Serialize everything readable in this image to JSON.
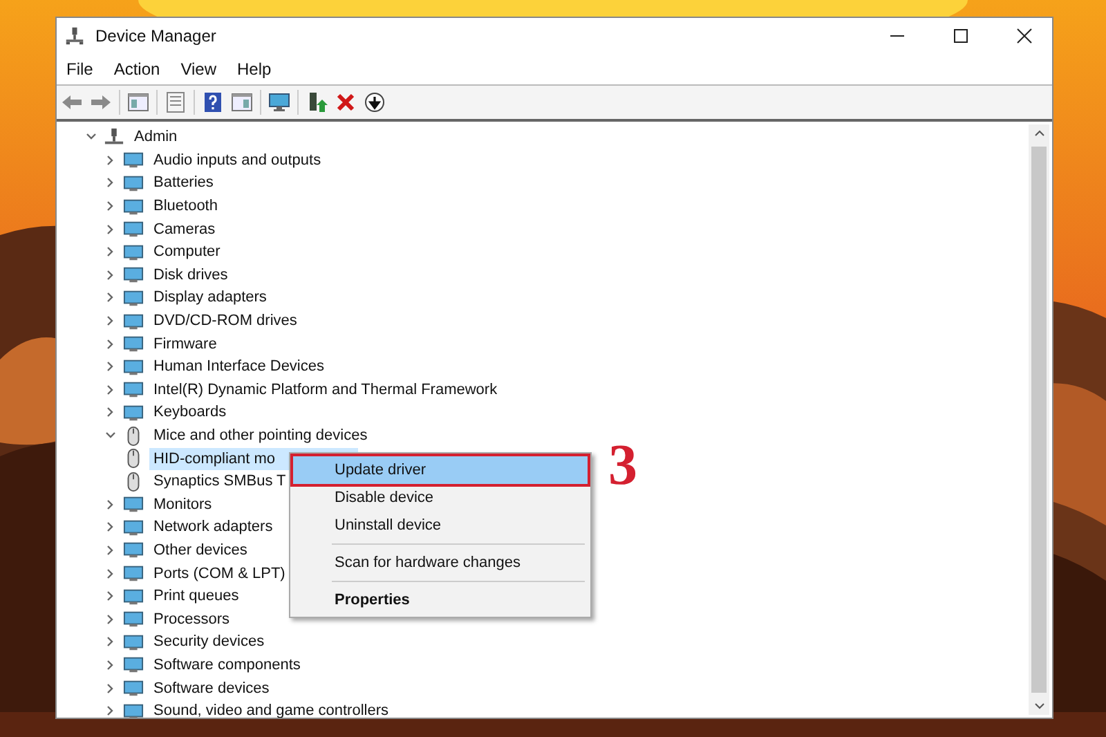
{
  "window": {
    "title": "Device Manager"
  },
  "menu_bar": [
    "File",
    "Action",
    "View",
    "Help"
  ],
  "toolbar": [
    {
      "kind": "back"
    },
    {
      "kind": "forward"
    },
    {
      "kind": "sep"
    },
    {
      "kind": "pane"
    },
    {
      "kind": "sep"
    },
    {
      "kind": "list"
    },
    {
      "kind": "sep"
    },
    {
      "kind": "help"
    },
    {
      "kind": "panel"
    },
    {
      "kind": "sep"
    },
    {
      "kind": "monitor"
    },
    {
      "kind": "sep"
    },
    {
      "kind": "enable"
    },
    {
      "kind": "remove"
    },
    {
      "kind": "download"
    }
  ],
  "tree": {
    "label": "Admin",
    "expanded": true,
    "selected": false,
    "children": [
      {
        "label": "Audio inputs and outputs",
        "expanded": false,
        "selected": false
      },
      {
        "label": "Batteries",
        "expanded": false,
        "selected": false
      },
      {
        "label": "Bluetooth",
        "expanded": false,
        "selected": false
      },
      {
        "label": "Cameras",
        "expanded": false,
        "selected": false
      },
      {
        "label": "Computer",
        "expanded": false,
        "selected": false
      },
      {
        "label": "Disk drives",
        "expanded": false,
        "selected": false
      },
      {
        "label": "Display adapters",
        "expanded": false,
        "selected": false
      },
      {
        "label": "DVD/CD-ROM drives",
        "expanded": false,
        "selected": false
      },
      {
        "label": "Firmware",
        "expanded": false,
        "selected": false
      },
      {
        "label": "Human Interface Devices",
        "expanded": false,
        "selected": false
      },
      {
        "label": "Intel(R) Dynamic Platform and Thermal Framework",
        "expanded": false,
        "selected": false
      },
      {
        "label": "Keyboards",
        "expanded": false,
        "selected": false
      },
      {
        "label": "Mice and other pointing devices",
        "expanded": true,
        "selected": false,
        "children": [
          {
            "label": "HID-compliant mo",
            "selected": true
          },
          {
            "label": "Synaptics SMBus T",
            "selected": false
          }
        ]
      },
      {
        "label": "Monitors",
        "expanded": false,
        "selected": false
      },
      {
        "label": "Network adapters",
        "expanded": false,
        "selected": false
      },
      {
        "label": "Other devices",
        "expanded": false,
        "selected": false
      },
      {
        "label": "Ports (COM & LPT)",
        "expanded": false,
        "selected": false
      },
      {
        "label": "Print queues",
        "expanded": false,
        "selected": false
      },
      {
        "label": "Processors",
        "expanded": false,
        "selected": false
      },
      {
        "label": "Security devices",
        "expanded": false,
        "selected": false
      },
      {
        "label": "Software components",
        "expanded": false,
        "selected": false
      },
      {
        "label": "Software devices",
        "expanded": false,
        "selected": false
      },
      {
        "label": "Sound, video and game controllers",
        "expanded": false,
        "selected": false
      }
    ]
  },
  "context_menu": {
    "items": [
      {
        "kind": "item",
        "label": "Update driver",
        "selected": true,
        "bold": false
      },
      {
        "kind": "item",
        "label": "Disable device",
        "selected": false,
        "bold": false
      },
      {
        "kind": "item",
        "label": "Uninstall device",
        "selected": false,
        "bold": false
      },
      {
        "kind": "separator"
      },
      {
        "kind": "item",
        "label": "Scan for hardware changes",
        "selected": false,
        "bold": false
      },
      {
        "kind": "separator"
      },
      {
        "kind": "item",
        "label": "Properties",
        "selected": false,
        "bold": true
      }
    ]
  },
  "annotation": {
    "label": "3"
  }
}
